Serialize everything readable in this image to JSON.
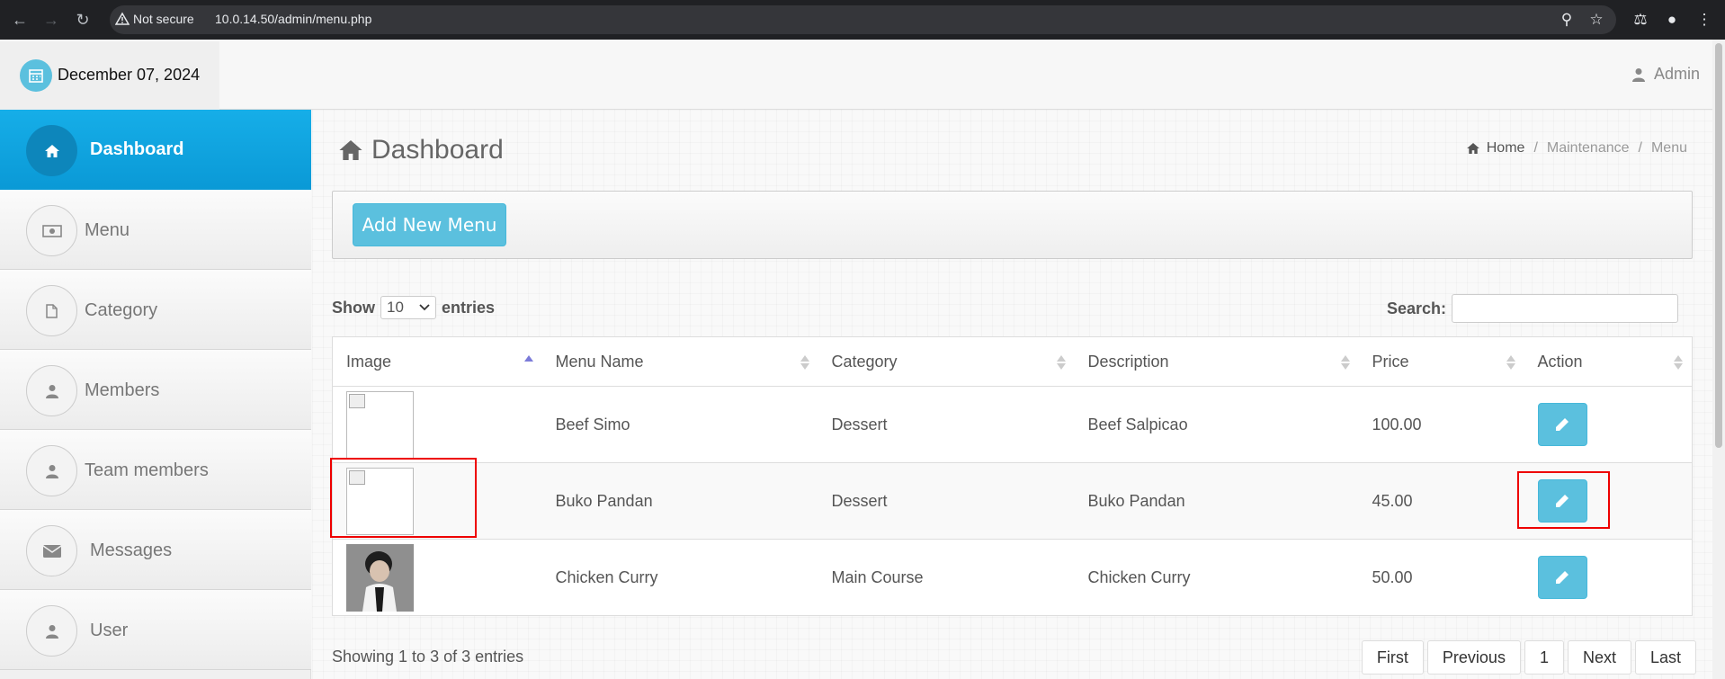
{
  "browser": {
    "security_label": "Not secure",
    "url": "10.0.14.50/admin/menu.php"
  },
  "topbar": {
    "date": "December 07, 2024",
    "user": "Admin"
  },
  "sidebar": {
    "items": [
      {
        "label": "Dashboard",
        "icon": "home-icon",
        "active": true
      },
      {
        "label": "Menu",
        "icon": "money-icon"
      },
      {
        "label": "Category",
        "icon": "file-icon"
      },
      {
        "label": "Members",
        "icon": "user-icon"
      },
      {
        "label": "Team members",
        "icon": "user-icon"
      },
      {
        "label": "Messages",
        "icon": "envelope-icon"
      },
      {
        "label": "User",
        "icon": "user-icon"
      }
    ]
  },
  "page": {
    "title": "Dashboard",
    "breadcrumb": [
      "Home",
      "Maintenance",
      "Menu"
    ],
    "add_button": "Add New Menu"
  },
  "table_controls": {
    "show": "Show",
    "entries_value": "10",
    "entries": "entries",
    "search_label": "Search:"
  },
  "table": {
    "headers": [
      "Image",
      "Menu Name",
      "Category",
      "Description",
      "Price",
      "Action"
    ],
    "rows": [
      {
        "name": "Beef Simo",
        "category": "Dessert",
        "description": "Beef Salpicao",
        "price": "100.00"
      },
      {
        "name": "Buko Pandan",
        "category": "Dessert",
        "description": "Buko Pandan",
        "price": "45.00"
      },
      {
        "name": "Chicken Curry",
        "category": "Main Course",
        "description": "Chicken Curry",
        "price": "50.00"
      }
    ]
  },
  "footer": {
    "info": "Showing 1 to 3 of 3 entries",
    "pager": [
      "First",
      "Previous",
      "1",
      "Next",
      "Last"
    ]
  },
  "colors": {
    "accent": "#5bc0de",
    "active": "#0a99d6",
    "highlight": "#ee0000"
  }
}
